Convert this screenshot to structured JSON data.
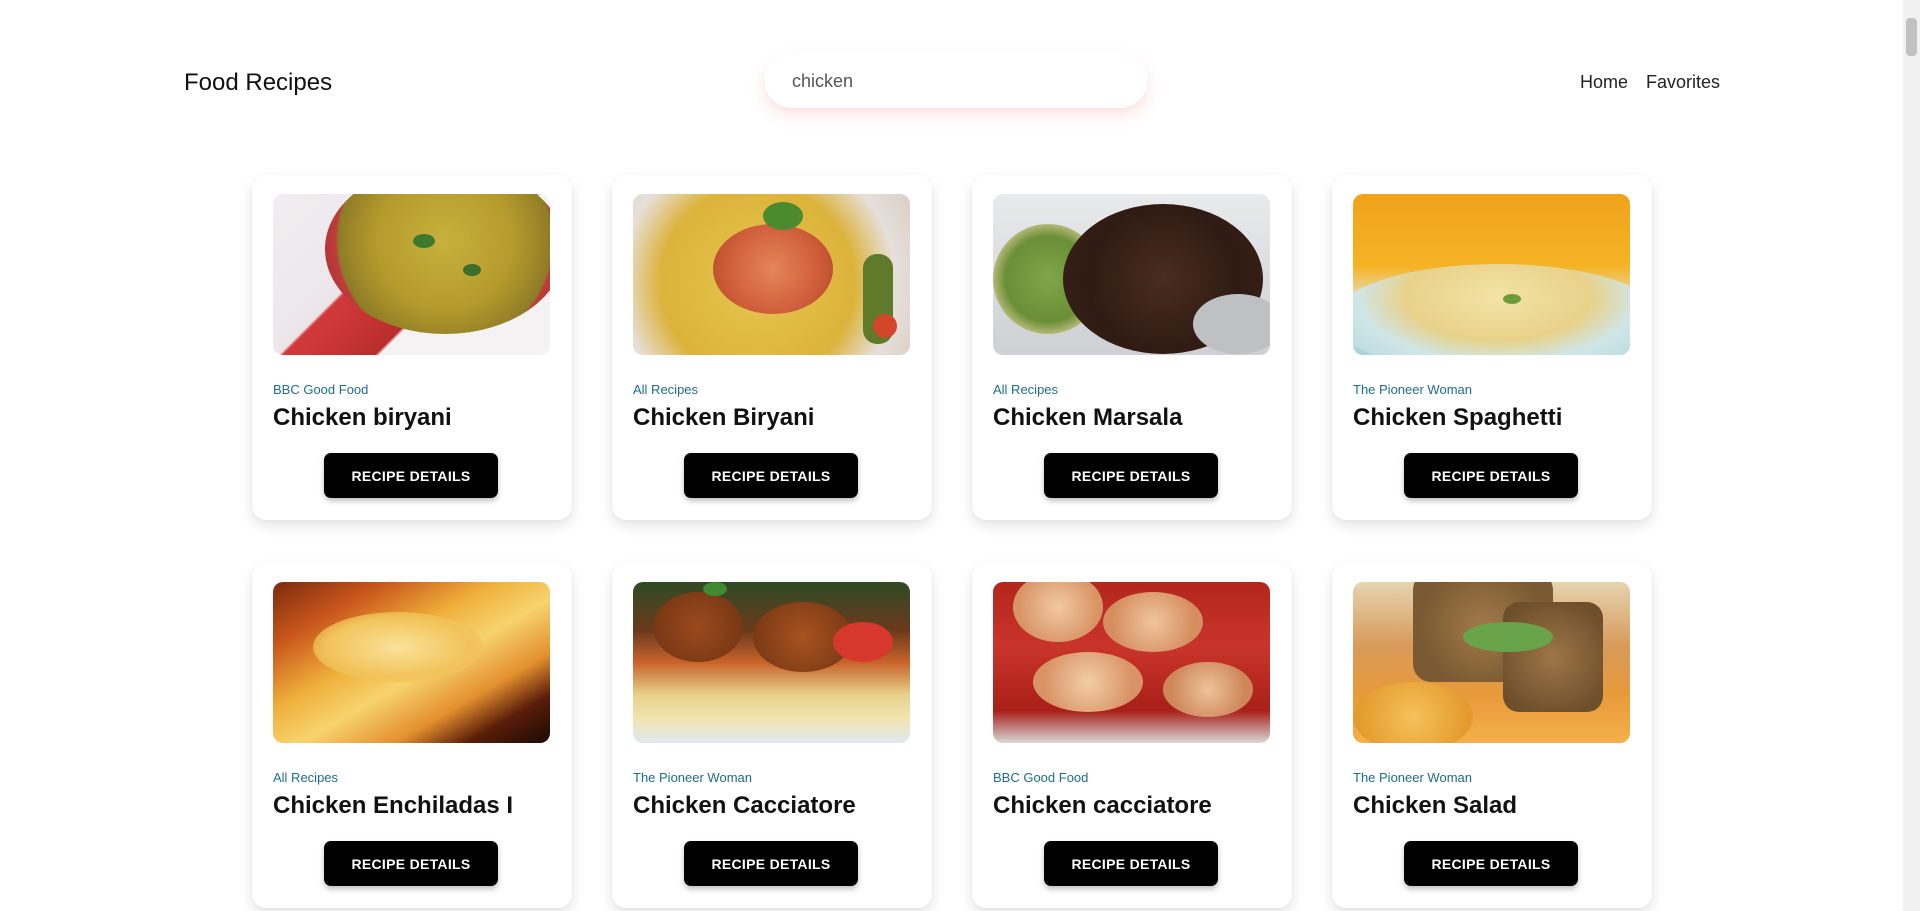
{
  "header": {
    "brand": "Food Recipes",
    "search": {
      "value": "chicken",
      "placeholder": "Search"
    },
    "nav": [
      {
        "label": "Home"
      },
      {
        "label": "Favorites"
      }
    ]
  },
  "recipes": [
    {
      "source": "BBC Good Food",
      "title": "Chicken biryani",
      "button": "RECIPE DETAILS"
    },
    {
      "source": "All Recipes",
      "title": "Chicken Biryani",
      "button": "RECIPE DETAILS"
    },
    {
      "source": "All Recipes",
      "title": "Chicken Marsala",
      "button": "RECIPE DETAILS"
    },
    {
      "source": "The Pioneer Woman",
      "title": "Chicken Spaghetti",
      "button": "RECIPE DETAILS"
    },
    {
      "source": "All Recipes",
      "title": "Chicken Enchiladas I",
      "button": "RECIPE DETAILS"
    },
    {
      "source": "The Pioneer Woman",
      "title": "Chicken Cacciatore",
      "button": "RECIPE DETAILS"
    },
    {
      "source": "BBC Good Food",
      "title": "Chicken cacciatore",
      "button": "RECIPE DETAILS"
    },
    {
      "source": "The Pioneer Woman",
      "title": "Chicken Salad",
      "button": "RECIPE DETAILS"
    }
  ],
  "colors": {
    "source_text": "#1f6c8a",
    "button_bg": "#000000"
  }
}
